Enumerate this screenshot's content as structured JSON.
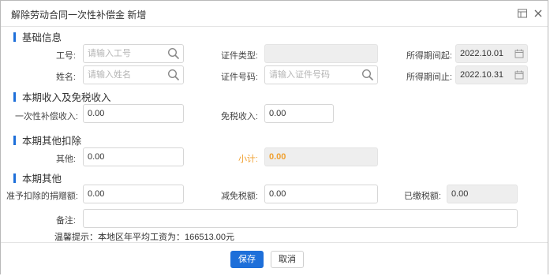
{
  "dialog": {
    "title": "解除劳动合同一次性补偿金 新增"
  },
  "sections": {
    "basic": "基础信息",
    "income": "本期收入及免税收入",
    "deduction": "本期其他扣除",
    "other": "本期其他"
  },
  "basic": {
    "emp_no_label": "工号:",
    "emp_no_placeholder": "请输入工号",
    "name_label": "姓名:",
    "name_placeholder": "请输入姓名",
    "id_type_label": "证件类型:",
    "id_type_value": "",
    "id_no_label": "证件号码:",
    "id_no_placeholder": "请输入证件号码",
    "period_start_label": "所得期间起:",
    "period_start_value": "2022.10.01",
    "period_end_label": "所得期间止:",
    "period_end_value": "2022.10.31"
  },
  "income": {
    "compensation_label": "一次性补偿收入:",
    "compensation_value": "0.00",
    "taxfree_label": "免税收入:",
    "taxfree_value": "0.00"
  },
  "deduction": {
    "other_label": "其他:",
    "other_value": "0.00",
    "subtotal_label": "小计:",
    "subtotal_value": "0.00"
  },
  "other": {
    "donation_label": "准予扣除的捐赠额:",
    "donation_value": "0.00",
    "tax_relief_label": "减免税额:",
    "tax_relief_value": "0.00",
    "paid_tax_label": "已缴税额:",
    "paid_tax_value": "0.00",
    "remark_label": "备注:",
    "remark_value": ""
  },
  "hint": "温馨提示：本地区年平均工资为：166513.00元",
  "footer": {
    "save_label": "保存",
    "cancel_label": "取消"
  },
  "colors": {
    "accent": "#1e6fd9",
    "subtotal": "#f0a030"
  }
}
